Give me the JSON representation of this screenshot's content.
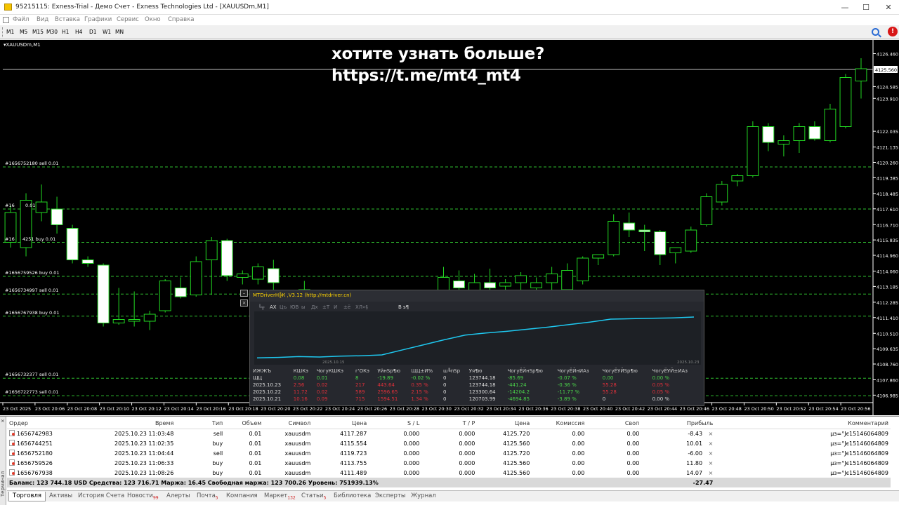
{
  "window": {
    "title": "95215115: Exness-Trial - Демо Счет - Exness Technologies Ltd - [XAUUSDm,M1]",
    "minimize": "—",
    "maximize": "☐",
    "close": "✕"
  },
  "menu": [
    "Файл",
    "Вид",
    "Вставка",
    "Графики",
    "Сервис",
    "Окно",
    "Справка"
  ],
  "timeframes": [
    "M1",
    "M5",
    "M15",
    "M30",
    "H1",
    "H4",
    "D1",
    "W1",
    "MN"
  ],
  "toolbar": {
    "alert_badge": "!"
  },
  "chart": {
    "symbol_label": "XAUUSDm,M1",
    "overlay_line1": "хотите узнать больше?",
    "overlay_line2": "https://t.me/mt4_mt4",
    "bid_label": "4125.560",
    "price_ticks": [
      "4126.460",
      "4124.585",
      "4123.910",
      "4122.035",
      "4121.135",
      "4120.260",
      "4119.385",
      "4118.485",
      "4117.610",
      "4116.710",
      "4115.835",
      "4114.960",
      "4114.060",
      "4113.185",
      "4112.285",
      "4111.410",
      "4110.510",
      "4109.635",
      "4108.760",
      "4107.860",
      "4106.985"
    ],
    "time_ticks": [
      "23 Oct 2025",
      "23 Oct 20:06",
      "23 Oct 20:08",
      "23 Oct 20:10",
      "23 Oct 20:12",
      "23 Oct 20:14",
      "23 Oct 20:16",
      "23 Oct 20:18",
      "23 Oct 20:20",
      "23 Oct 20:22",
      "23 Oct 20:24",
      "23 Oct 20:26",
      "23 Oct 20:28",
      "23 Oct 20:30",
      "23 Oct 20:32",
      "23 Oct 20:34",
      "23 Oct 20:36",
      "23 Oct 20:38",
      "23 Oct 20:40",
      "23 Oct 20:42",
      "23 Oct 20:44",
      "23 Oct 20:46",
      "23 Oct 20:48",
      "23 Oct 20:50",
      "23 Oct 20:52",
      "23 Oct 20:54",
      "23 Oct 20:56"
    ],
    "order_labels": [
      {
        "text": "#1656752180 sell 0.01",
        "price": 4120.0
      },
      {
        "text": "#16",
        "price": 4117.6
      },
      {
        "text": "0.01",
        "price": 4117.6
      },
      {
        "text": "#16",
        "price": 4115.7
      },
      {
        "text": "4251 buy 0.01",
        "price": 4115.7
      },
      {
        "text": "#1656759526 buy 0.01",
        "price": 4113.76
      },
      {
        "text": "#1656734997 sell 0.01",
        "price": 4112.75
      },
      {
        "text": "#1656767938 buy 0.01",
        "price": 4111.49
      },
      {
        "text": "#1656732377 sell 0.01",
        "price": 4107.95
      },
      {
        "text": "#1656722773 sell 0.01",
        "price": 4106.95
      }
    ]
  },
  "chart_data": {
    "type": "candlestick",
    "ylim": [
      4106.6,
      4127.0
    ],
    "ask_price": 4125.56,
    "candles": [
      {
        "o": 4115.7,
        "h": 4117.8,
        "l": 4115.4,
        "c": 4117.4
      },
      {
        "o": 4115.4,
        "h": 4118.5,
        "l": 4114.9,
        "c": 4118.1
      },
      {
        "o": 4117.4,
        "h": 4119.0,
        "l": 4116.9,
        "c": 4118.0
      },
      {
        "o": 4117.6,
        "h": 4118.3,
        "l": 4116.2,
        "c": 4116.7
      },
      {
        "o": 4116.5,
        "h": 4116.7,
        "l": 4114.5,
        "c": 4114.7
      },
      {
        "o": 4114.7,
        "h": 4114.9,
        "l": 4114.3,
        "c": 4114.5
      },
      {
        "o": 4114.4,
        "h": 4114.5,
        "l": 4110.9,
        "c": 4111.1
      },
      {
        "o": 4111.1,
        "h": 4113.1,
        "l": 4111.0,
        "c": 4111.3
      },
      {
        "o": 4111.2,
        "h": 4112.9,
        "l": 4110.9,
        "c": 4111.3
      },
      {
        "o": 4111.2,
        "h": 4111.8,
        "l": 4110.7,
        "c": 4111.6
      },
      {
        "o": 4111.8,
        "h": 4113.6,
        "l": 4111.7,
        "c": 4113.5
      },
      {
        "o": 4113.1,
        "h": 4113.7,
        "l": 4112.5,
        "c": 4112.6
      },
      {
        "o": 4112.7,
        "h": 4114.9,
        "l": 4112.6,
        "c": 4114.6
      },
      {
        "o": 4114.7,
        "h": 4116.0,
        "l": 4112.7,
        "c": 4115.8
      },
      {
        "o": 4115.8,
        "h": 4115.9,
        "l": 4113.5,
        "c": 4113.8
      },
      {
        "o": 4113.7,
        "h": 4114.1,
        "l": 4113.3,
        "c": 4113.9
      },
      {
        "o": 4113.6,
        "h": 4114.5,
        "l": 4113.3,
        "c": 4114.3
      },
      {
        "o": 4114.2,
        "h": 4114.7,
        "l": 4112.8,
        "c": 4113.4
      },
      {
        "o": 4112.5,
        "h": 4113.0,
        "l": 4112.0,
        "c": 4112.8
      },
      {
        "o": 4112.5,
        "h": 4113.5,
        "l": 4111.8,
        "c": 4113.0
      },
      {
        "o": 4112.4,
        "h": 4112.9,
        "l": 4111.9,
        "c": 4112.6
      },
      {
        "o": 4112.6,
        "h": 4113.0,
        "l": 4111.9,
        "c": 4112.2
      },
      {
        "o": 4112.4,
        "h": 4112.8,
        "l": 4111.8,
        "c": 4112.5
      },
      {
        "o": 4112.5,
        "h": 4112.9,
        "l": 4111.7,
        "c": 4112.0
      },
      {
        "o": 4112.0,
        "h": 4112.3,
        "l": 4111.6,
        "c": 4112.1
      },
      {
        "o": 4112.1,
        "h": 4112.4,
        "l": 4111.9,
        "c": 4112.2
      },
      {
        "o": 4112.2,
        "h": 4112.4,
        "l": 4111.6,
        "c": 4111.9
      },
      {
        "o": 4111.9,
        "h": 4112.2,
        "l": 4111.5,
        "c": 4112.0
      },
      {
        "o": 4112.3,
        "h": 4114.3,
        "l": 4112.1,
        "c": 4113.7
      },
      {
        "o": 4113.5,
        "h": 4114.1,
        "l": 4113.0,
        "c": 4113.1
      },
      {
        "o": 4112.8,
        "h": 4113.9,
        "l": 4112.6,
        "c": 4113.4
      },
      {
        "o": 4113.4,
        "h": 4114.2,
        "l": 4112.9,
        "c": 4113.1
      },
      {
        "o": 4113.2,
        "h": 4113.6,
        "l": 4112.7,
        "c": 4113.4
      },
      {
        "o": 4113.4,
        "h": 4114.0,
        "l": 4112.9,
        "c": 4113.8
      },
      {
        "o": 4113.1,
        "h": 4113.7,
        "l": 4112.7,
        "c": 4113.4
      },
      {
        "o": 4113.4,
        "h": 4114.3,
        "l": 4113.0,
        "c": 4113.9
      },
      {
        "o": 4113.0,
        "h": 4114.5,
        "l": 4112.6,
        "c": 4114.1
      },
      {
        "o": 4113.5,
        "h": 4114.9,
        "l": 4113.3,
        "c": 4114.8
      },
      {
        "o": 4114.8,
        "h": 4115.0,
        "l": 4114.4,
        "c": 4115.0
      },
      {
        "o": 4115.0,
        "h": 4117.3,
        "l": 4114.9,
        "c": 4116.9
      },
      {
        "o": 4116.8,
        "h": 4117.4,
        "l": 4116.0,
        "c": 4116.4
      },
      {
        "o": 4116.4,
        "h": 4116.7,
        "l": 4115.2,
        "c": 4116.3
      },
      {
        "o": 4116.3,
        "h": 4116.4,
        "l": 4114.4,
        "c": 4115.0
      },
      {
        "o": 4115.1,
        "h": 4115.3,
        "l": 4114.5,
        "c": 4115.4
      },
      {
        "o": 4115.2,
        "h": 4116.6,
        "l": 4115.1,
        "c": 4116.4
      },
      {
        "o": 4116.7,
        "h": 4118.5,
        "l": 4116.6,
        "c": 4118.3
      },
      {
        "o": 4118.0,
        "h": 4119.2,
        "l": 4117.8,
        "c": 4119.0
      },
      {
        "o": 4119.2,
        "h": 4119.6,
        "l": 4118.9,
        "c": 4119.5
      },
      {
        "o": 4119.5,
        "h": 4122.6,
        "l": 4119.4,
        "c": 4122.3
      },
      {
        "o": 4122.3,
        "h": 4122.5,
        "l": 4120.9,
        "c": 4121.4
      },
      {
        "o": 4121.3,
        "h": 4121.8,
        "l": 4120.6,
        "c": 4121.5
      },
      {
        "o": 4121.5,
        "h": 4122.5,
        "l": 4120.8,
        "c": 4122.3
      },
      {
        "o": 4122.3,
        "h": 4122.6,
        "l": 4121.5,
        "c": 4121.6
      },
      {
        "o": 4121.5,
        "h": 4123.6,
        "l": 4121.4,
        "c": 4123.3
      },
      {
        "o": 4122.3,
        "h": 4125.3,
        "l": 4122.2,
        "c": 4125.1
      },
      {
        "o": 4124.9,
        "h": 4126.2,
        "l": 4123.9,
        "c": 4125.6
      }
    ]
  },
  "panel": {
    "title": "MTDriverН╠К ,V3.12 (http://mtdriver.cn)",
    "tabs": [
      "╚╦",
      "АХ",
      "Цъ",
      "ЮВ",
      "ы",
      "Дх",
      "±Т",
      "И",
      "±ё",
      "ХЛ»§",
      "В s¶"
    ],
    "active_tab_index": 1,
    "date_start": "2025.10.15",
    "date_end": "2025.10.23",
    "columns": [
      "ИЖЖЪ",
      "КШКэ",
      "ЧогуКШКэ",
      "г'ОКэ",
      "УйнЅр¶ю",
      "ЩЦ±И%",
      "ш╚пЅр",
      "Уя¶ю",
      "ЧогуЁЙнЅр¶ю",
      "ЧогуЁЙнИАз",
      "ЧогуЁУЙЅр¶ю",
      "ЧогуЁУЙ±ИАз"
    ],
    "rows": [
      [
        "ЩЦ",
        "0.08",
        "0.01",
        "8",
        "-19.89",
        "-0.02 %",
        "0",
        "123744.18",
        "-85.69",
        "-0.07 %",
        "0.00",
        "0.00 %"
      ],
      [
        "2025.10.23",
        "2.56",
        "0.02",
        "217",
        "443.64",
        "0.35 %",
        "0",
        "123744.18",
        "-441.24",
        "-0.36 %",
        "55.28",
        "0.05 %"
      ],
      [
        "2025.10.22",
        "11.72",
        "0.02",
        "589",
        "2596.65",
        "2.15 %",
        "0",
        "123300.64",
        "-14204.2",
        "-11.77 %",
        "55.28",
        "0.05 %"
      ],
      [
        "2025.10.21",
        "10.16",
        "0.09",
        "715",
        "1594.51",
        "1.34 %",
        "0",
        "120703.99",
        "-4694.85",
        "-3.89 %",
        "0",
        "0.00 %"
      ]
    ],
    "curve": [
      0.03,
      0.04,
      0.06,
      0.05,
      0.07,
      0.08,
      0.1,
      0.22,
      0.34,
      0.46,
      0.57,
      0.62,
      0.66,
      0.71,
      0.76,
      0.82,
      0.88,
      0.95,
      0.96,
      0.97,
      0.98,
      1.0
    ]
  },
  "terminal": {
    "vlabel": "Терминал",
    "close": "×",
    "headers": [
      "Ордер",
      "Время",
      "Тип",
      "Объем",
      "Символ",
      "Цена",
      "S / L",
      "T / P",
      "Цена",
      "Комиссия",
      "Своп",
      "Прибыль",
      "Комментарий"
    ],
    "orders": [
      [
        "1656742983",
        "2025.10.23 11:03:48",
        "sell",
        "0.01",
        "xauusdm",
        "4117.287",
        "0.000",
        "0.000",
        "4125.720",
        "0.00",
        "0.00",
        "-8.43",
        "µз=°Jє15146064809"
      ],
      [
        "1656744251",
        "2025.10.23 11:02:35",
        "buy",
        "0.01",
        "xauusdm",
        "4115.554",
        "0.000",
        "0.000",
        "4125.560",
        "0.00",
        "0.00",
        "10.01",
        "µз=°Jє15146064809"
      ],
      [
        "1656752180",
        "2025.10.23 11:04:44",
        "sell",
        "0.01",
        "xauusdm",
        "4119.723",
        "0.000",
        "0.000",
        "4125.720",
        "0.00",
        "0.00",
        "-6.00",
        "µз=°Jє15146064809"
      ],
      [
        "1656759526",
        "2025.10.23 11:06:33",
        "buy",
        "0.01",
        "xauusdm",
        "4113.755",
        "0.000",
        "0.000",
        "4125.560",
        "0.00",
        "0.00",
        "11.80",
        "µз=°Jє15146064809"
      ],
      [
        "1656767938",
        "2025.10.23 11:08:26",
        "buy",
        "0.01",
        "xauusdm",
        "4111.489",
        "0.000",
        "0.000",
        "4125.560",
        "0.00",
        "0.00",
        "14.07",
        "µз=°Jє15146064809"
      ]
    ],
    "balance_line": "Баланс: 123 744.18 USD  Средства: 123 716.71  Маржа: 16.45  Свободная маржа: 123 700.26  Уровень: 751939.13%",
    "total_profit": "-27.47",
    "tabs": [
      {
        "label": "Торговля",
        "badge": ""
      },
      {
        "label": "Активы",
        "badge": ""
      },
      {
        "label": "История Счета",
        "badge": ""
      },
      {
        "label": "Новости",
        "badge": "99"
      },
      {
        "label": "Алерты",
        "badge": ""
      },
      {
        "label": "Почта",
        "badge": "5"
      },
      {
        "label": "Компания",
        "badge": ""
      },
      {
        "label": "Маркет",
        "badge": "132"
      },
      {
        "label": "Статьи",
        "badge": "5"
      },
      {
        "label": "Библиотека",
        "badge": ""
      },
      {
        "label": "Эксперты",
        "badge": ""
      },
      {
        "label": "Журнал",
        "badge": ""
      }
    ]
  }
}
